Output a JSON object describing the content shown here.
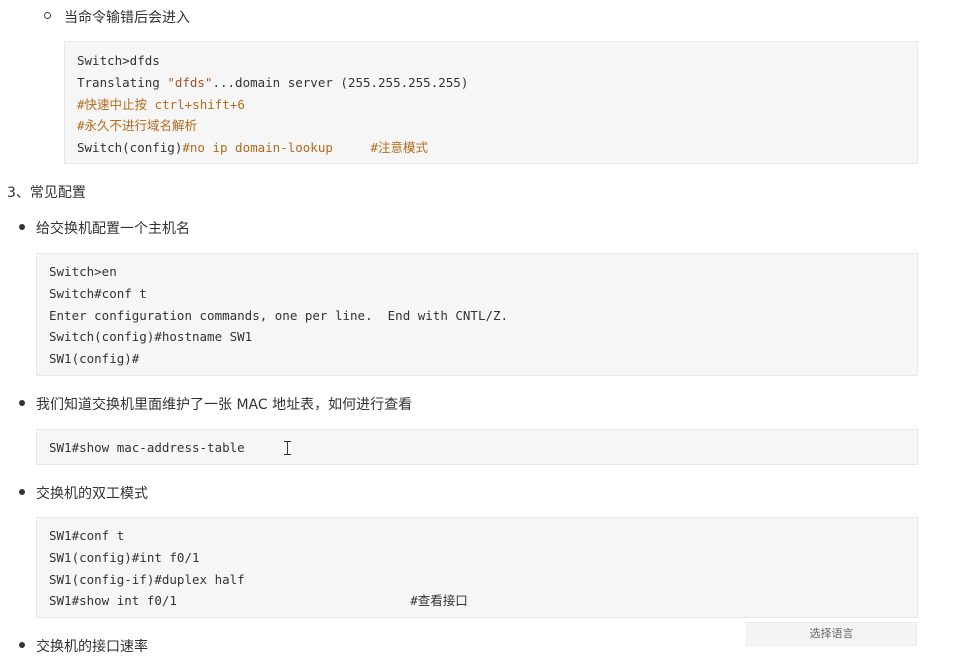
{
  "items": {
    "b1": "当命令输错后会进入",
    "heading3": "3、常见配置",
    "b2": "给交换机配置一个主机名",
    "b3": "我们知道交换机里面维护了一张 MAC 地址表，如何进行查看",
    "b4": "交换机的双工模式",
    "b5": "交换机的接口速率"
  },
  "code1": {
    "l1": "Switch>dfds",
    "l2a": "Translating ",
    "l2b": "\"dfds\"",
    "l2c": "...domain server (255.255.255.255)",
    "l3": "#快速中止按 ctrl+shift+6",
    "l4": "#永久不进行域名解析",
    "l5a": "Switch(config)",
    "l5b": "#no ip domain-lookup     #注意模式"
  },
  "code2": {
    "l1": "Switch>en",
    "l2": "Switch#conf t",
    "l3": "Enter configuration commands, one per line.  End with CNTL/Z.",
    "l4": "Switch(config)#hostname SW1",
    "l5": "SW1(config)#"
  },
  "code3": {
    "l1": "SW1#show mac-address-table"
  },
  "code4": {
    "l1": "SW1#conf t",
    "l2": "SW1(config)#int f0/1",
    "l3": "SW1(config-if)#duplex half",
    "l4": "SW1#show int f0/1                               #查看接口"
  },
  "lang": {
    "label": "选择语言"
  },
  "colors": {
    "comment": "#b36b1c",
    "code_bg": "#f6f6f6"
  }
}
